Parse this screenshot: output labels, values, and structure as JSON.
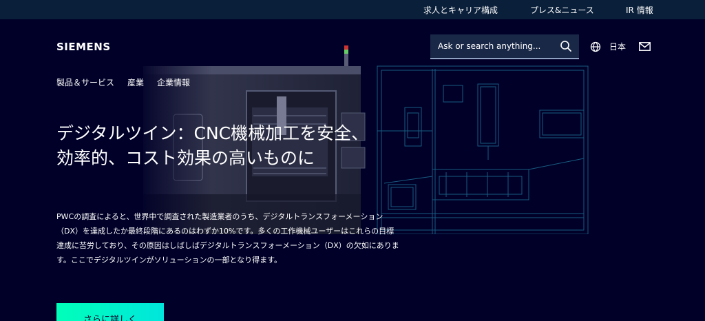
{
  "topbar": {
    "links": [
      "求人とキャリア構成",
      "プレス&ニュース",
      "IR 情報"
    ]
  },
  "header": {
    "logo": "SIEMENS",
    "search_placeholder": "Ask or search anything...",
    "language": "日本",
    "icons": [
      "search-icon",
      "globe-icon",
      "mail-icon"
    ]
  },
  "nav": {
    "items": [
      "製品＆サービス",
      "産業",
      "企業情報"
    ]
  },
  "hero": {
    "headline": "デジタルツイン：CNC機械加工を安全、効率的、コスト効果の高いものに",
    "description": "PWCの調査によると、世界中で調査された製造業者のうち、デジタルトランスフォーメーション（DX）を達成したか最終段階にあるのはわずか10%です。多くの工作機械ユーザーはこれらの目標達成に苦労しており、その原因はしばしばデジタルトランスフォーメーション（DX）の欠如にあります。ここでデジタルツインがソリューションの一部となり得ます。",
    "cta_label": "さらに詳しく"
  },
  "colors": {
    "background": "#000028",
    "topbar": "#0a1f3a",
    "accent": "#00ffb9"
  }
}
